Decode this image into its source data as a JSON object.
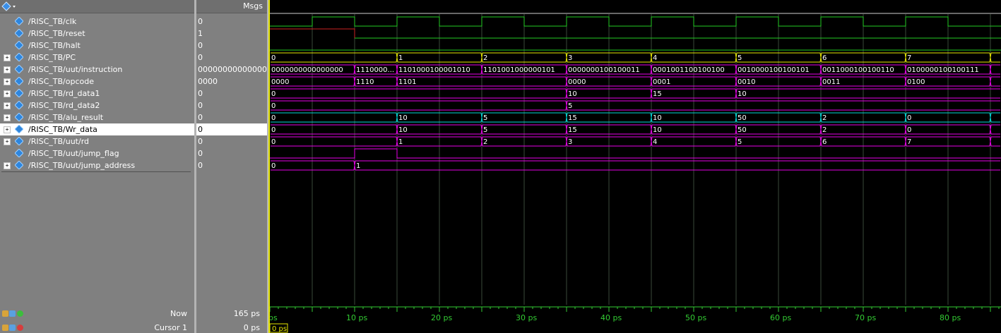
{
  "headers": {
    "values": "Msgs"
  },
  "signals": [
    {
      "name": "/RISC_TB/clk",
      "value": "0",
      "expandable": false,
      "selected": false
    },
    {
      "name": "/RISC_TB/reset",
      "value": "1",
      "expandable": false,
      "selected": false
    },
    {
      "name": "/RISC_TB/halt",
      "value": "0",
      "expandable": false,
      "selected": false
    },
    {
      "name": "/RISC_TB/PC",
      "value": "0",
      "expandable": true,
      "selected": false
    },
    {
      "name": "/RISC_TB/uut/instruction",
      "value": "0000000000000000",
      "expandable": true,
      "selected": false
    },
    {
      "name": "/RISC_TB/opcode",
      "value": "0000",
      "expandable": true,
      "selected": false
    },
    {
      "name": "/RISC_TB/rd_data1",
      "value": "0",
      "expandable": true,
      "selected": false
    },
    {
      "name": "/RISC_TB/rd_data2",
      "value": "0",
      "expandable": true,
      "selected": false
    },
    {
      "name": "/RISC_TB/alu_result",
      "value": "0",
      "expandable": true,
      "selected": false
    },
    {
      "name": "/RISC_TB/Wr_data",
      "value": "0",
      "expandable": true,
      "selected": true
    },
    {
      "name": "/RISC_TB/uut/rd",
      "value": "0",
      "expandable": true,
      "selected": false
    },
    {
      "name": "/RISC_TB/uut/jump_flag",
      "value": "0",
      "expandable": false,
      "selected": false
    },
    {
      "name": "/RISC_TB/uut/jump_address",
      "value": "0",
      "expandable": true,
      "selected": false
    }
  ],
  "waves": {
    "clk": {
      "type": "clock",
      "high": [
        [
          5,
          10
        ],
        [
          15,
          20
        ],
        [
          25,
          30
        ],
        [
          35,
          40
        ],
        [
          45,
          50
        ],
        [
          55,
          60
        ],
        [
          65,
          70
        ],
        [
          75,
          80
        ]
      ]
    },
    "reset": {
      "type": "bit",
      "transitions": [
        [
          0,
          1
        ],
        [
          10,
          0
        ]
      ]
    },
    "halt": {
      "type": "bit",
      "transitions": [
        [
          0,
          0
        ]
      ]
    },
    "PC": {
      "type": "bus",
      "color": "#e6e600",
      "segments": [
        [
          0,
          "0"
        ],
        [
          15,
          "1"
        ],
        [
          25,
          "2"
        ],
        [
          35,
          "3"
        ],
        [
          45,
          "4"
        ],
        [
          55,
          "5"
        ],
        [
          65,
          "6"
        ],
        [
          75,
          "7"
        ],
        [
          85,
          ""
        ]
      ]
    },
    "instruction": {
      "type": "bus",
      "color": "#e800e8",
      "segments": [
        [
          0,
          "0000000000000000"
        ],
        [
          10,
          "1110000..."
        ],
        [
          15,
          "1101000100001010"
        ],
        [
          25,
          "1101001000000101"
        ],
        [
          35,
          "0000000100100011"
        ],
        [
          45,
          "0001001100100100"
        ],
        [
          55,
          "0010000100100101"
        ],
        [
          65,
          "0011000100100110"
        ],
        [
          75,
          "0100000100100111"
        ],
        [
          85,
          ""
        ]
      ]
    },
    "opcode": {
      "type": "bus",
      "color": "#e800e8",
      "segments": [
        [
          0,
          "0000"
        ],
        [
          10,
          "1110"
        ],
        [
          15,
          "1101"
        ],
        [
          35,
          "0000"
        ],
        [
          45,
          "0001"
        ],
        [
          55,
          "0010"
        ],
        [
          65,
          "0011"
        ],
        [
          75,
          "0100"
        ],
        [
          85,
          ""
        ]
      ]
    },
    "rd_data1": {
      "type": "bus",
      "color": "#e800e8",
      "segments": [
        [
          0,
          "0"
        ],
        [
          35,
          "10"
        ],
        [
          45,
          "15"
        ],
        [
          55,
          "10"
        ]
      ]
    },
    "rd_data2": {
      "type": "bus",
      "color": "#e800e8",
      "segments": [
        [
          0,
          "0"
        ],
        [
          35,
          "5"
        ]
      ]
    },
    "alu_result": {
      "type": "bus",
      "color": "#00d8d8",
      "segments": [
        [
          0,
          "0"
        ],
        [
          15,
          "10"
        ],
        [
          25,
          "5"
        ],
        [
          35,
          "15"
        ],
        [
          45,
          "10"
        ],
        [
          55,
          "50"
        ],
        [
          65,
          "2"
        ],
        [
          75,
          "0"
        ],
        [
          85,
          ""
        ]
      ]
    },
    "Wr_data": {
      "type": "bus",
      "color": "#e800e8",
      "segments": [
        [
          0,
          "0"
        ],
        [
          15,
          "10"
        ],
        [
          25,
          "5"
        ],
        [
          35,
          "15"
        ],
        [
          45,
          "10"
        ],
        [
          55,
          "50"
        ],
        [
          65,
          "2"
        ],
        [
          75,
          "0"
        ],
        [
          85,
          ""
        ]
      ]
    },
    "rd": {
      "type": "bus",
      "color": "#e800e8",
      "segments": [
        [
          0,
          "0"
        ],
        [
          15,
          "1"
        ],
        [
          25,
          "2"
        ],
        [
          35,
          "3"
        ],
        [
          45,
          "4"
        ],
        [
          55,
          "5"
        ],
        [
          65,
          "6"
        ],
        [
          75,
          "7"
        ],
        [
          85,
          ""
        ]
      ]
    },
    "jump_flag": {
      "type": "bit",
      "transitions": [
        [
          0,
          0
        ],
        [
          10,
          1
        ],
        [
          15,
          0
        ]
      ],
      "color": "#e800e8"
    },
    "jump_address": {
      "type": "bus",
      "color": "#e800e8",
      "segments": [
        [
          0,
          "0"
        ],
        [
          10,
          "1"
        ]
      ]
    }
  },
  "timeline": {
    "tick_labels": [
      "ps",
      "10 ps",
      "20 ps",
      "30 ps",
      "40 ps",
      "50 ps",
      "60 ps",
      "70 ps",
      "80 ps"
    ],
    "now_label": "Now",
    "now_value": "165 ps",
    "cursor_label": "Cursor 1",
    "cursor_value": "0 ps",
    "cursor_flag": "0 ps"
  },
  "colors": {
    "clock": "#22cc22",
    "reset": "#cc2222",
    "grid": "#3a4a3a",
    "cursor": "#e8e800",
    "timeline": "#33cc33"
  }
}
